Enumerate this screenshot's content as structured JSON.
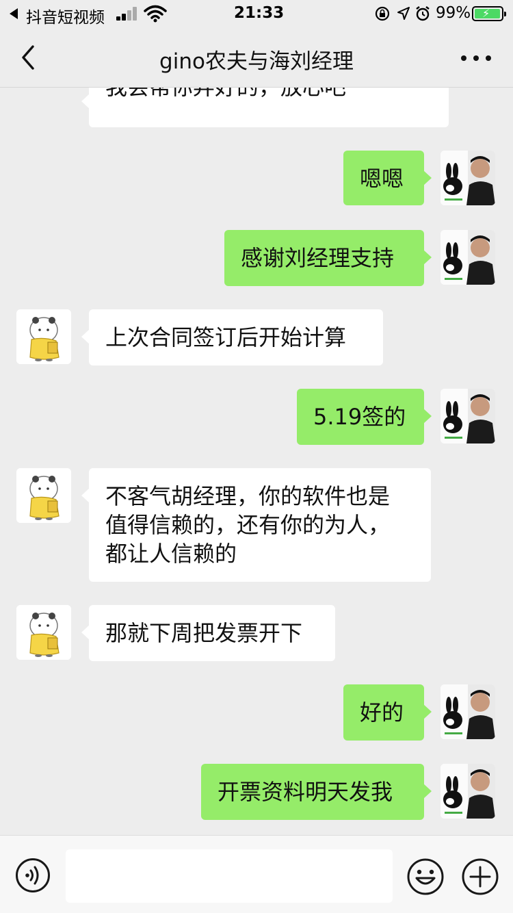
{
  "status_bar": {
    "back_app": "抖音短视频",
    "time": "21:33",
    "battery": "99%"
  },
  "nav": {
    "title": "gino农夫与海刘经理"
  },
  "messages": [
    {
      "direction": "in",
      "text": "我会帮你弄好的，放心吧"
    },
    {
      "direction": "out",
      "text": "嗯嗯"
    },
    {
      "direction": "out",
      "text": "感谢刘经理支持"
    },
    {
      "direction": "in",
      "text": "上次合同签订后开始计算"
    },
    {
      "direction": "out",
      "text": "5.19签的"
    },
    {
      "direction": "in",
      "text": "不客气胡经理，你的软件也是\n值得信赖的，还有你的为人，\n都让人信赖的"
    },
    {
      "direction": "in",
      "text": "那就下周把发票开下"
    },
    {
      "direction": "out",
      "text": "好的"
    },
    {
      "direction": "out",
      "text": "开票资料明天发我"
    }
  ],
  "input": {
    "value": "",
    "placeholder": ""
  },
  "colors": {
    "outgoing_bubble": "#95ec69",
    "incoming_bubble": "#ffffff",
    "background": "#ededed"
  },
  "icons": {
    "back": "chevron-left-icon",
    "more": "more-dots-icon",
    "voice": "voice-icon",
    "emoji": "emoji-icon",
    "plus": "plus-circle-icon"
  }
}
